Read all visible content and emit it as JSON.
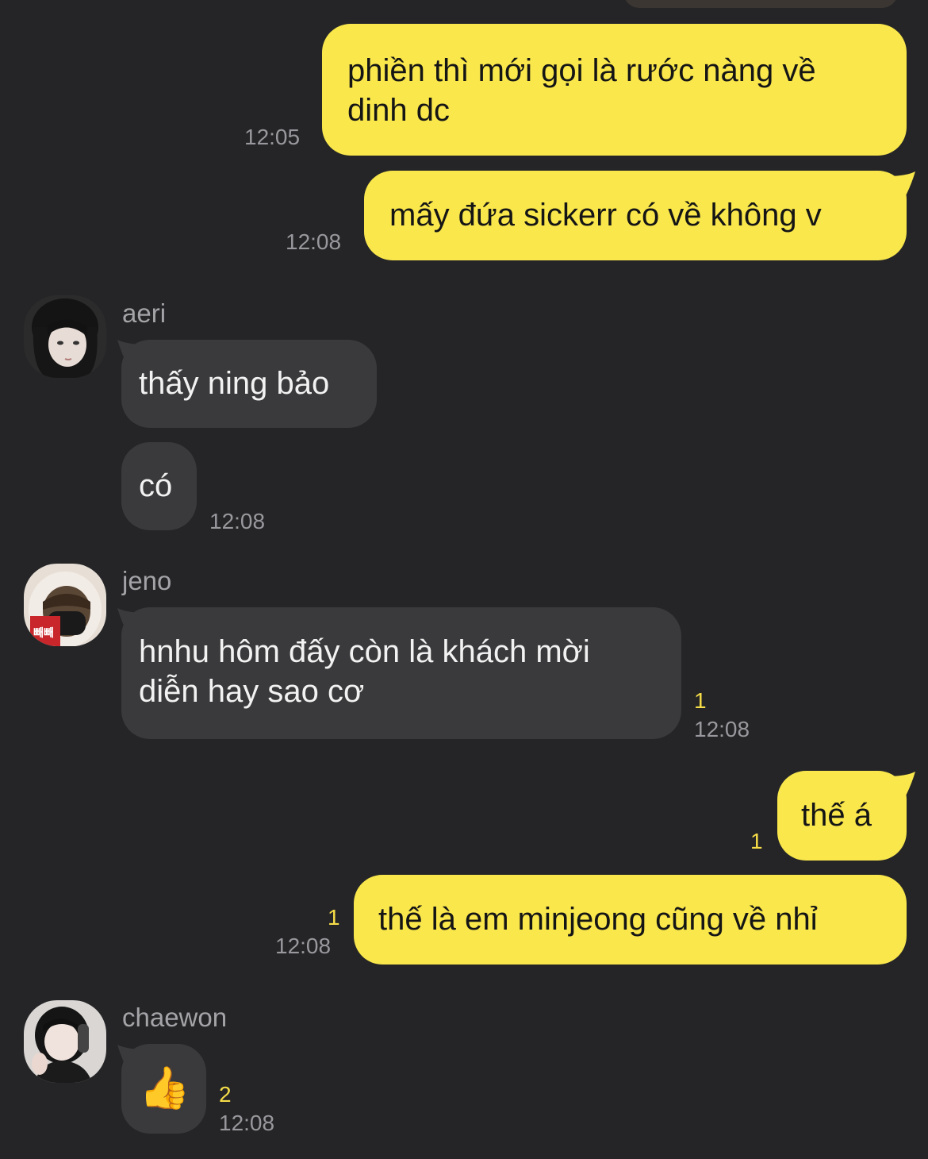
{
  "messages": [
    {
      "from": "me",
      "lines": [
        "phiền thì mới gọi là rước nàng về",
        "dinh dc"
      ],
      "time": "12:05"
    },
    {
      "from": "me",
      "lines": [
        "mấy đứa sickerr có về không v"
      ],
      "time": "12:08"
    },
    {
      "from": "aeri",
      "lines": [
        "thấy ning bảo"
      ]
    },
    {
      "from": "aeri",
      "lines": [
        "có"
      ],
      "time": "12:08"
    },
    {
      "from": "jeno",
      "lines": [
        "hnhu hôm đấy còn là khách mời",
        "diễn hay sao cơ"
      ],
      "unread": "1",
      "time": "12:08"
    },
    {
      "from": "me",
      "lines": [
        "thế á"
      ],
      "unread": "1"
    },
    {
      "from": "me",
      "lines": [
        "thế là em minjeong cũng về nhỉ"
      ],
      "unread": "1",
      "time": "12:08"
    },
    {
      "from": "chaewon",
      "emoji": "👍",
      "unread": "2",
      "time": "12:08"
    }
  ],
  "senders": {
    "aeri": "aeri",
    "jeno": "jeno",
    "chaewon": "chaewon"
  },
  "colors": {
    "background": "#252527",
    "my_bubble": "#f9e74c",
    "their_bubble": "#3a3a3c",
    "unread_count": "#f5dc48",
    "timestamp": "#98989d"
  }
}
